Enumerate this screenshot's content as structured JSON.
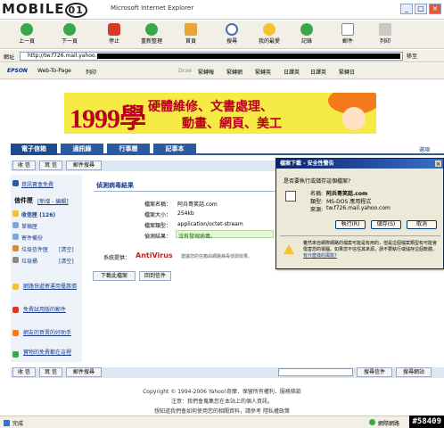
{
  "watermark_brand": "MOBILE01",
  "window": {
    "title": "Microsoft Internet Explorer"
  },
  "toolbar": {
    "buttons": [
      {
        "label": "上一頁",
        "icon": "back-arrow-icon"
      },
      {
        "label": "下一頁",
        "icon": "forward-arrow-icon"
      },
      {
        "label": "停止",
        "icon": "stop-icon"
      },
      {
        "label": "重新整理",
        "icon": "refresh-icon"
      },
      {
        "label": "首頁",
        "icon": "home-icon"
      },
      {
        "label": "搜尋",
        "icon": "search-icon"
      },
      {
        "label": "我的最愛",
        "icon": "favorites-icon"
      },
      {
        "label": "記錄",
        "icon": "history-icon"
      },
      {
        "label": "郵件",
        "icon": "mail-icon"
      },
      {
        "label": "列印",
        "icon": "print-icon"
      }
    ]
  },
  "address": {
    "url": "http://tw.f726.mail.yahoo.com",
    "go_label": "移至"
  },
  "links_bar": {
    "brand": "EPSON",
    "items": [
      "Web-To-Page",
      "列印",
      "Dcxe",
      "緊轉報",
      "緊轉網",
      "緊轉英",
      "日譯英",
      "日譯英",
      "緊轉日"
    ]
  },
  "banner": {
    "number": "1999學",
    "line1": "硬體維修、文書處理、",
    "line2": "動畫、網頁、美工"
  },
  "tabs": [
    {
      "label": "電子信箱"
    },
    {
      "label": "通訊錄"
    },
    {
      "label": "行事曆"
    },
    {
      "label": "記事本"
    }
  ],
  "tab_right_link": "選項",
  "action_buttons": {
    "receive": "收 信",
    "compose": "寫 信",
    "search": "郵件搜尋"
  },
  "sidebar": {
    "top_link": "資訊寶盒免費",
    "mailbox_header": "信件匣",
    "new_link": "[新增 - 編輯]",
    "folders": [
      {
        "name": "收信匣",
        "count": "(126)"
      },
      {
        "name": "草稿匣",
        "count": ""
      },
      {
        "name": "寄件備份",
        "count": ""
      },
      {
        "name": "垃圾信件匣",
        "count": "[清空]"
      },
      {
        "name": "垃圾桶",
        "count": "[清空]"
      }
    ],
    "promos": [
      "網路快遞寄運用優惠價",
      "免費試用版的郵件",
      "網友的買賣的好助手",
      "寶物的免費都在這裡"
    ]
  },
  "scan": {
    "title": "偵測病毒結果",
    "rows": [
      {
        "label": "檔案名稱：",
        "value": "阿兵哥笑話.com"
      },
      {
        "label": "檔案大小：",
        "value": "254kb"
      },
      {
        "label": "檔案類型：",
        "value": "application/octet-stream"
      },
      {
        "label": "偵測結果：",
        "value": "沒有發現病毒。"
      }
    ],
    "provider_label": "系統提供：",
    "provider_brand": "AntiVirus",
    "provider_note": "建議您的信箱由網路病毒偵測效果。",
    "download_button": "下載此檔案",
    "back_button": "回到信件"
  },
  "dialog": {
    "title": "檔案下載 - 安全性警告",
    "question": "是否要執行或儲存這個檔案?",
    "name_label": "名稱:",
    "name_value": "阿兵哥笑話.com",
    "type_label": "類型:",
    "type_value": "MS-DOS 應用程式",
    "from_label": "來源:",
    "from_value": "tw.f726.mail.yahoo.com",
    "run_button": "執行(R)",
    "save_button": "儲存(S)",
    "cancel_button": "取消",
    "warning_text": "雖然來自網際網路的檔案可能是有用的，但是這個檔案類型有可能會傷害您的電腦。如果您不信任其來源，請不要執行或儲存這個軟體。",
    "risk_link": "有什麼樣的風險?"
  },
  "bottom_bar": {
    "receive": "收 信",
    "compose": "寫 信",
    "search": "郵件搜尋",
    "search_select": "搜尋信件",
    "search_web": "搜尋網站"
  },
  "footer": {
    "copyright": "Copyright © 1994-2006 Yahoo!奇摩．保留所有權利．服務條款",
    "line2": "注意：我們會蒐集您在本站上的個人資訊。",
    "line3": "想知道我們會如何使用您的相關資料，請參考 隱私權政策"
  },
  "status": {
    "left": "完成",
    "right": "網際網路",
    "watermark": "#58409"
  }
}
